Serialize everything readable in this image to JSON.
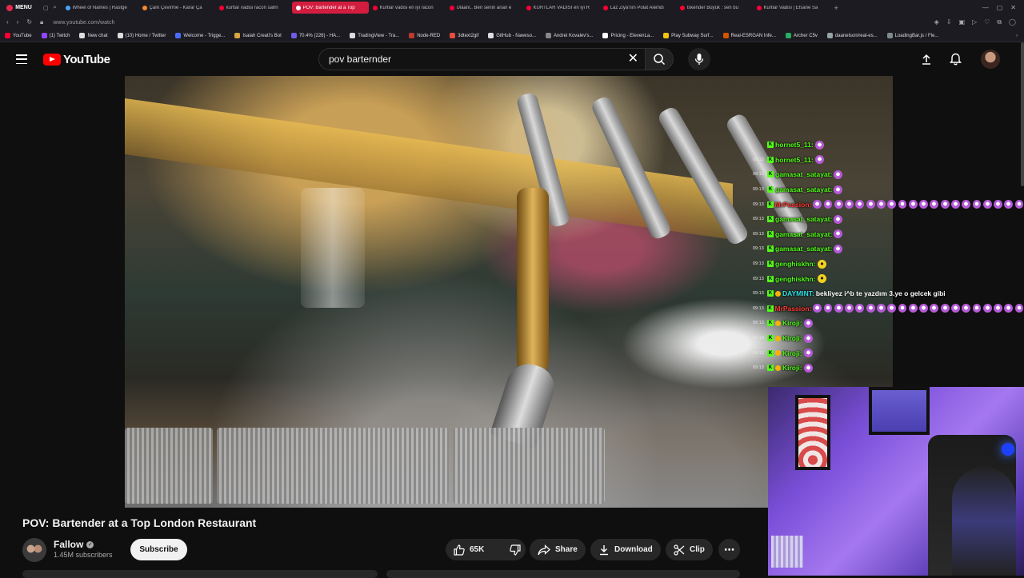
{
  "browser": {
    "menu_label": "MENU",
    "tabs": [
      {
        "label": "Wheel of Names | Rastge",
        "color": "#4aa3ff",
        "active": false
      },
      {
        "label": "Çark Çevirme - Karar Ça",
        "color": "#f28b2b",
        "active": false
      },
      {
        "label": "kurtlar vadisi racon sahn",
        "color": "#ff0033",
        "active": false
      },
      {
        "label": "POV: Bartender at a Top",
        "color": "#ff0033",
        "active": true
      },
      {
        "label": "Kurtlar vadisi en iyi racon",
        "color": "#ff0033",
        "active": false
      },
      {
        "label": "Ulaani.. Ben senin anan e",
        "color": "#ff0033",
        "active": false
      },
      {
        "label": "KURTLAR VADİSİ en iyi R",
        "color": "#ff0033",
        "active": false
      },
      {
        "label": "Laz Ziya'nın Polat Alemdi",
        "color": "#ff0033",
        "active": false
      },
      {
        "label": "İskender Büyük : sen bu",
        "color": "#ff0033",
        "active": false
      },
      {
        "label": "Kurtlar Vadisi | Efsane Sa",
        "color": "#ff0033",
        "active": false
      }
    ],
    "url": "www.youtube.com/watch",
    "bookmarks": [
      {
        "label": "YouTube",
        "color": "#ff0033"
      },
      {
        "label": "(1) Twitch",
        "color": "#9146ff"
      },
      {
        "label": "New chat",
        "color": "#dddddd"
      },
      {
        "label": "(10) Home / Twitter",
        "color": "#dddddd"
      },
      {
        "label": "Welcome - Trigge...",
        "color": "#4a6bff"
      },
      {
        "label": "Isaiah Creati's Bot",
        "color": "#d9a441"
      },
      {
        "label": "70.4% (226) - HA...",
        "color": "#6c5ce7"
      },
      {
        "label": "TradingView - Tra...",
        "color": "#dddddd"
      },
      {
        "label": "Node-RED",
        "color": "#c0392b"
      },
      {
        "label": "3dtext2gif",
        "color": "#e74c3c"
      },
      {
        "label": "GitHub - f/aweso...",
        "color": "#dddddd"
      },
      {
        "label": "Andrei Kovalev's...",
        "color": "#888888"
      },
      {
        "label": "Pricing - ElevenLa...",
        "color": "#ffffff"
      },
      {
        "label": "Play Subway Surf...",
        "color": "#f1c40f"
      },
      {
        "label": "Real-ESRGAN Infe...",
        "color": "#d35400"
      },
      {
        "label": "Archer C5v",
        "color": "#27ae60"
      },
      {
        "label": "daanelson/real-es...",
        "color": "#95a5a6"
      },
      {
        "label": "LoadingBar.js / Fle...",
        "color": "#7f8c8d"
      }
    ]
  },
  "header": {
    "logo_text": "YouTube",
    "search_value": "pov barternder"
  },
  "chat": [
    {
      "time": "",
      "user": "hornet5_11:",
      "user_color": "#53fc18",
      "badge": false,
      "emotes": 1,
      "emote_kind": "purple",
      "msg": ""
    },
    {
      "time": "09:13",
      "user": "hornet5_11:",
      "user_color": "#53fc18",
      "badge": false,
      "emotes": 1,
      "emote_kind": "purple",
      "msg": ""
    },
    {
      "time": "09:13",
      "user": "gamasat_satayat:",
      "user_color": "#53fc18",
      "badge": false,
      "emotes": 1,
      "emote_kind": "purple",
      "msg": ""
    },
    {
      "time": "09:13",
      "user": "gamasat_satayat:",
      "user_color": "#53fc18",
      "badge": false,
      "emotes": 1,
      "emote_kind": "purple",
      "msg": ""
    },
    {
      "time": "09:13",
      "user": "MrPassion:",
      "user_color": "#ff3b30",
      "badge": false,
      "emotes": 20,
      "emote_kind": "purple",
      "msg": ""
    },
    {
      "time": "09:13",
      "user": "gamasat_satayat:",
      "user_color": "#53fc18",
      "badge": false,
      "emotes": 1,
      "emote_kind": "purple",
      "msg": ""
    },
    {
      "time": "09:13",
      "user": "gamasat_satayat:",
      "user_color": "#53fc18",
      "badge": false,
      "emotes": 1,
      "emote_kind": "purple",
      "msg": ""
    },
    {
      "time": "09:13",
      "user": "gamasat_satayat:",
      "user_color": "#53fc18",
      "badge": false,
      "emotes": 1,
      "emote_kind": "purple",
      "msg": ""
    },
    {
      "time": "09:13",
      "user": "genghiskhn:",
      "user_color": "#53fc18",
      "badge": false,
      "emotes": 1,
      "emote_kind": "yellow",
      "msg": ""
    },
    {
      "time": "09:13",
      "user": "genghiskhn:",
      "user_color": "#53fc18",
      "badge": false,
      "emotes": 1,
      "emote_kind": "yellow",
      "msg": ""
    },
    {
      "time": "09:13",
      "user": "DAYMINT:",
      "user_color": "#2de2e6",
      "badge": true,
      "emotes": 0,
      "emote_kind": "purple",
      "msg": "bekliyez i^b te yazdım 3.ye o gelcek gibi"
    },
    {
      "time": "09:13",
      "user": "MrPassion:",
      "user_color": "#ff3b30",
      "badge": false,
      "emotes": 20,
      "emote_kind": "purple",
      "msg": ""
    },
    {
      "time": "09:13",
      "user": "Kiroji:",
      "user_color": "#53fc18",
      "badge": true,
      "emotes": 1,
      "emote_kind": "purple",
      "msg": ""
    },
    {
      "time": "09:13",
      "user": "Kiroji:",
      "user_color": "#53fc18",
      "badge": true,
      "emotes": 1,
      "emote_kind": "purple",
      "msg": ""
    },
    {
      "time": "09:13",
      "user": "Kiroji:",
      "user_color": "#53fc18",
      "badge": true,
      "emotes": 1,
      "emote_kind": "purple",
      "msg": ""
    },
    {
      "time": "09:13",
      "user": "Kiroji:",
      "user_color": "#53fc18",
      "badge": true,
      "emotes": 1,
      "emote_kind": "purple",
      "msg": ""
    }
  ],
  "video": {
    "title": "POV: Bartender at a Top London Restaurant",
    "channel": "Fallow",
    "subscribers": "1.45M subscribers",
    "subscribe_label": "Subscribe",
    "likes": "65K",
    "share_label": "Share",
    "download_label": "Download",
    "clip_label": "Clip"
  }
}
